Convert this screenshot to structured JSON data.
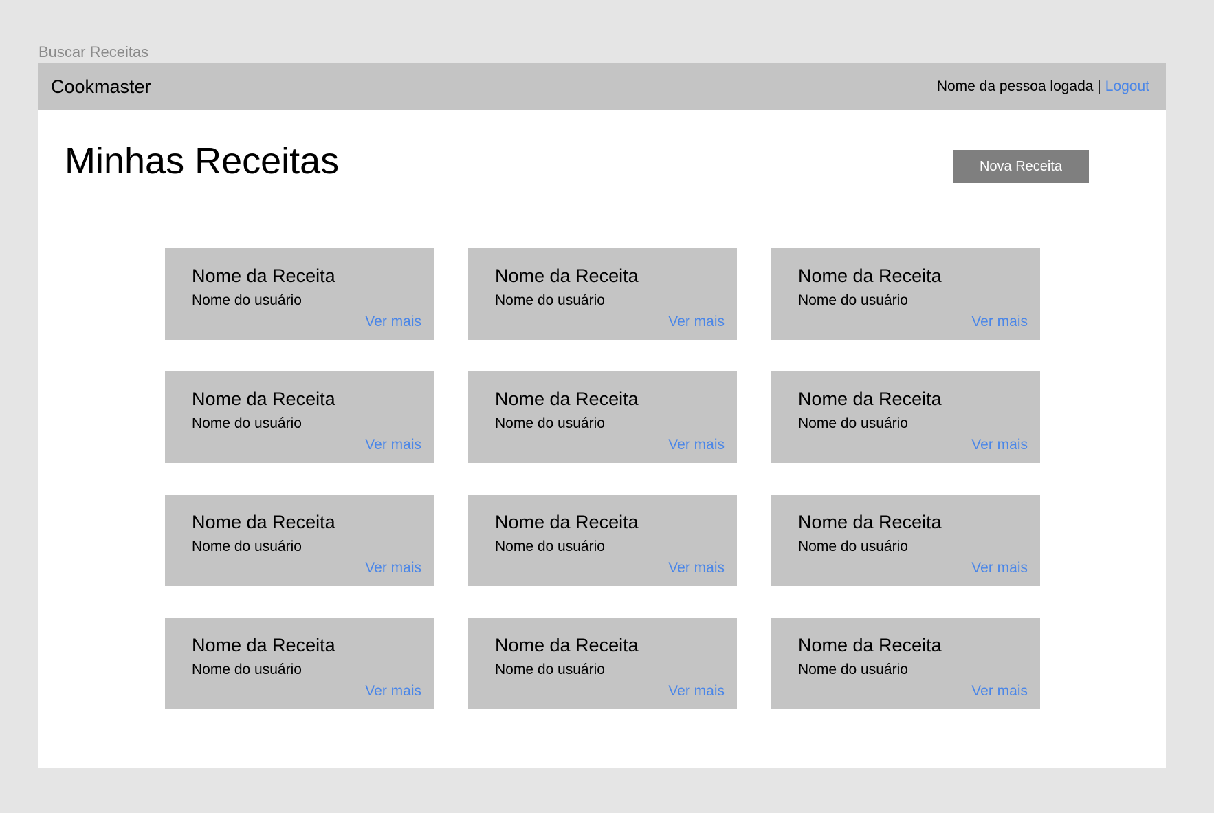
{
  "frame_label": "Buscar Receitas",
  "header": {
    "brand": "Cookmaster",
    "user_name": "Nome da pessoa logada |",
    "logout_label": "Logout"
  },
  "main": {
    "title": "Minhas Receitas",
    "new_recipe_label": "Nova Receita"
  },
  "recipes": [
    {
      "name": "Nome da Receita",
      "user": "Nome do usuário",
      "link": "Ver mais"
    },
    {
      "name": "Nome da Receita",
      "user": "Nome do usuário",
      "link": "Ver mais"
    },
    {
      "name": "Nome da Receita",
      "user": "Nome do usuário",
      "link": "Ver mais"
    },
    {
      "name": "Nome da Receita",
      "user": "Nome do usuário",
      "link": "Ver mais"
    },
    {
      "name": "Nome da Receita",
      "user": "Nome do usuário",
      "link": "Ver mais"
    },
    {
      "name": "Nome da Receita",
      "user": "Nome do usuário",
      "link": "Ver mais"
    },
    {
      "name": "Nome da Receita",
      "user": "Nome do usuário",
      "link": "Ver mais"
    },
    {
      "name": "Nome da Receita",
      "user": "Nome do usuário",
      "link": "Ver mais"
    },
    {
      "name": "Nome da Receita",
      "user": "Nome do usuário",
      "link": "Ver mais"
    },
    {
      "name": "Nome da Receita",
      "user": "Nome do usuário",
      "link": "Ver mais"
    },
    {
      "name": "Nome da Receita",
      "user": "Nome do usuário",
      "link": "Ver mais"
    },
    {
      "name": "Nome da Receita",
      "user": "Nome do usuário",
      "link": "Ver mais"
    }
  ],
  "colors": {
    "background": "#e5e5e5",
    "surface": "#ffffff",
    "bar_and_card": "#c4c4c4",
    "button": "#7f7f7f",
    "link": "#4a86e8"
  }
}
